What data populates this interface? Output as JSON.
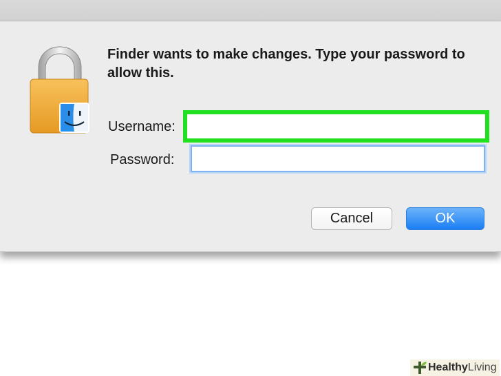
{
  "dialog": {
    "message": "Finder wants to make changes. Type your password to allow this.",
    "lock_icon": "lock-finder-icon"
  },
  "form": {
    "username_label": "Username:",
    "username_value": "",
    "password_label": "Password:",
    "password_value": ""
  },
  "buttons": {
    "cancel": "Cancel",
    "ok": "OK"
  },
  "watermark": {
    "icon": "cross-plant-logo",
    "strong": "Healthy",
    "light": "Living"
  },
  "colors": {
    "highlight": "#21e021",
    "ok_button": "#1b7ef3",
    "focus_ring": "#7fb2ee"
  }
}
